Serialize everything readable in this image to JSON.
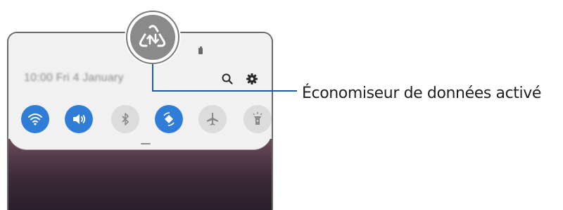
{
  "quick_panel": {
    "datetime": "10:00  Fri 4 January",
    "toggles": [
      {
        "name": "wifi-icon",
        "state": "on"
      },
      {
        "name": "volume-icon",
        "state": "on"
      },
      {
        "name": "bluetooth-icon",
        "state": "off"
      },
      {
        "name": "auto-rotate-icon",
        "state": "on"
      },
      {
        "name": "airplane-mode-icon",
        "state": "off"
      },
      {
        "name": "flashlight-icon",
        "state": "off"
      }
    ],
    "header_icons": [
      "search-icon",
      "gear-icon"
    ]
  },
  "callout": {
    "icon": "data-saver-icon",
    "label": "Économiseur de données activé"
  },
  "colors": {
    "toggle_on": "#2f7dd9",
    "toggle_off": "#dcdcdc",
    "leader_line": "#1e5aa8",
    "panel_bg": "#f1f1f1"
  }
}
